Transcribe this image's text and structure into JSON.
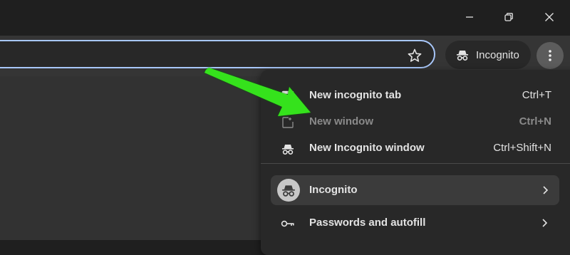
{
  "window_controls": {
    "minimize_icon": "minimize-icon",
    "restore_icon": "restore-icon",
    "close_icon": "close-icon"
  },
  "toolbar": {
    "omnibox_value": "",
    "bookmark_icon": "star-icon",
    "incognito_chip_label": "Incognito",
    "menu_icon": "kebab-menu-icon"
  },
  "menu": {
    "items": [
      {
        "label": "New incognito tab",
        "shortcut": "Ctrl+T",
        "icon": "tab-icon",
        "disabled": false
      },
      {
        "label": "New window",
        "shortcut": "Ctrl+N",
        "icon": "new-window-icon",
        "disabled": true
      },
      {
        "label": "New Incognito window",
        "shortcut": "Ctrl+Shift+N",
        "icon": "incognito-icon",
        "disabled": false
      }
    ],
    "profile": {
      "label": "Incognito",
      "icon": "incognito-avatar-icon"
    },
    "passwords": {
      "label": "Passwords and autofill",
      "icon": "key-icon"
    }
  },
  "annotation": {
    "arrow_color": "#35e21b",
    "icon": "green-arrow"
  },
  "colors": {
    "focus_ring": "#a8c7fa",
    "menu_bg": "#282828",
    "toolbar_bg": "#353535"
  }
}
